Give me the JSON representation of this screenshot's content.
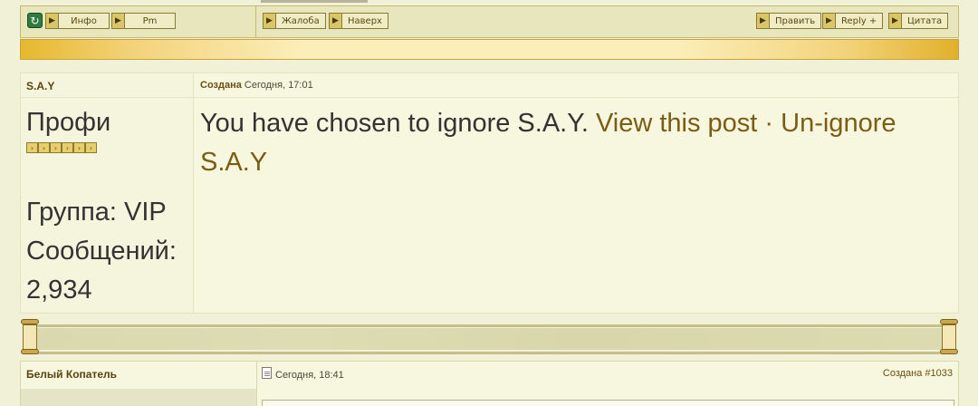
{
  "toolbar_left": {
    "info_label": "Инфо",
    "pm_label": "Pm"
  },
  "toolbar_mid": {
    "complaint_label": "Жалоба",
    "top_label": "Наверх"
  },
  "toolbar_right": {
    "edit_label": "Править",
    "reply_label": "Reply +",
    "quote_label": "Цитата"
  },
  "post": {
    "author": "S.A.Y",
    "created_label": "Создана",
    "created_time": "Сегодня, 17:01",
    "rank": "Профи",
    "rank_pips": 6,
    "group": "Группа: VIP",
    "messages_label": "Сообщений:",
    "messages_count": "2,934",
    "ignore_text": "You have chosen to ignore S.A.Y.",
    "view_link": "View this post",
    "separator": "·",
    "unignore_link": "Un-ignore S.A.Y"
  },
  "next_post": {
    "author": "Белый Копатель",
    "date": "Сегодня, 18:41",
    "post_number": "Создана #1033"
  },
  "colors": {
    "accent_gold": "#e6b82e",
    "link": "#7a5d14",
    "background": "#f1f1d8"
  },
  "icons": [
    "refresh-icon",
    "arrow-icon",
    "document-icon",
    "scroll-icon"
  ]
}
